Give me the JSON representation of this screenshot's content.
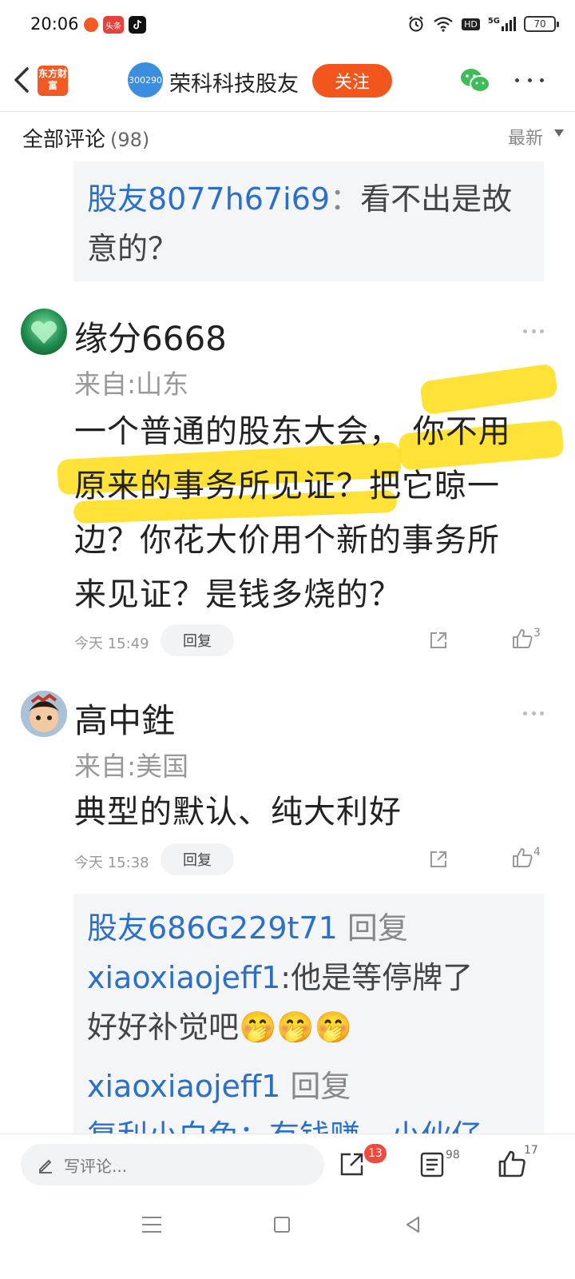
{
  "status_bar": {
    "time": "20:06",
    "app_icons": [
      {
        "name": "app-notification-icon",
        "label": "",
        "color": "#f15a22"
      },
      {
        "name": "toutiao-icon",
        "label": "头条",
        "color": "#e8403a"
      },
      {
        "name": "tiktok-icon",
        "label": "",
        "color": "#111111"
      }
    ],
    "battery": "70",
    "signal_label": "5G",
    "hd_label": "HD"
  },
  "header": {
    "app_logo": "东方财富",
    "stock_code": "300290",
    "title": "荣科科技股友",
    "follow_label": "关注",
    "accent_color": "#f2561d"
  },
  "comments_section": {
    "title": "全部评论",
    "count": "(98)",
    "sort_label": "最新"
  },
  "comments": [
    {
      "username": "缘分6668",
      "location": "来自:山东",
      "body_lines": [
        "一个普通的股东大会， 你不用",
        "原来的事务所见证？把它晾一",
        "边？你花大价用个新的事务所",
        "来见证？是钱多烧的？"
      ],
      "time": "今天 15:49",
      "reply_label": "回复",
      "likes": "3"
    },
    {
      "username": "高中鉎",
      "location": "来自:美国",
      "body_lines": [
        "典型的默认、纯大利好"
      ],
      "time": "今天 15:38",
      "reply_label": "回复",
      "likes": "4"
    }
  ],
  "top_reply": {
    "name": "股友8077h67i69",
    "separator": "：",
    "text_line1": "看不出是故",
    "text_line2": "意的？"
  },
  "sub_replies": {
    "line1_name": "股友686G229t71",
    "line1_suffix": "回复",
    "line2_name": "xiaoxiaojeff1",
    "line2_text": ":他是等停牌了",
    "line3_text": "好好补觉吧🤭🤭🤭",
    "line4_name": "xiaoxiaojeff1",
    "line4_suffix": "回复",
    "line5_text": "复利小白兔：有钱赚，小伙仔"
  },
  "bottom_bar": {
    "input_placeholder": "写评论...",
    "share_badge": "13",
    "comment_count": "98",
    "like_count": "17"
  },
  "colors": {
    "link_blue": "#2a6fc9",
    "highlight": "#ffda00",
    "badge_red": "#f04a3c"
  }
}
